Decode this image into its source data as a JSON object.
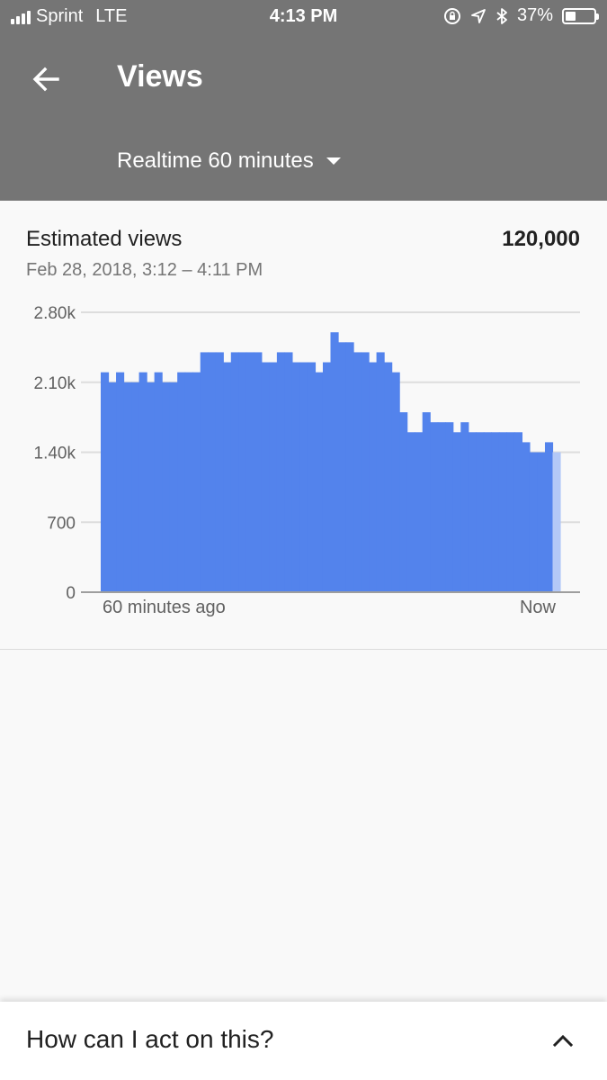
{
  "status_bar": {
    "carrier": "Sprint",
    "network": "LTE",
    "time": "4:13 PM",
    "battery_percent_label": "37%",
    "battery_level": 0.37,
    "icons": [
      "signal-icon",
      "rotation-lock-icon",
      "location-icon",
      "bluetooth-icon",
      "battery-icon"
    ]
  },
  "header": {
    "title": "Views",
    "period_selector": "Realtime 60 minutes",
    "back_icon": "arrow-left-icon",
    "dropdown_icon": "caret-down-icon"
  },
  "metric": {
    "label": "Estimated views",
    "value": "120,000",
    "date_range": "Feb 28, 2018, 3:12 – 4:11 PM"
  },
  "chart_data": {
    "type": "bar",
    "title": "",
    "xlabel": "",
    "ylabel": "",
    "ylim": [
      0,
      2800
    ],
    "yticks": [
      {
        "value": 0,
        "label": "0"
      },
      {
        "value": 700,
        "label": "700"
      },
      {
        "value": 1400,
        "label": "1.40k"
      },
      {
        "value": 2100,
        "label": "2.10k"
      },
      {
        "value": 2800,
        "label": "2.80k"
      }
    ],
    "x_start_label": "60 minutes ago",
    "x_end_label": "Now",
    "grid": true,
    "bar_color": "#5383EC",
    "current_bar_color": "#B3C8F7",
    "values": [
      2200,
      2100,
      2200,
      2100,
      2100,
      2200,
      2100,
      2200,
      2100,
      2100,
      2200,
      2200,
      2200,
      2400,
      2400,
      2400,
      2300,
      2400,
      2400,
      2400,
      2400,
      2300,
      2300,
      2400,
      2400,
      2300,
      2300,
      2300,
      2200,
      2300,
      2600,
      2500,
      2500,
      2400,
      2400,
      2300,
      2400,
      2300,
      2200,
      1800,
      1600,
      1600,
      1800,
      1700,
      1700,
      1700,
      1600,
      1700,
      1600,
      1600,
      1600,
      1600,
      1600,
      1600,
      1600,
      1500,
      1400,
      1400,
      1500,
      1400
    ]
  },
  "colors": {
    "header_bg": "#757575",
    "page_bg": "#F9F9F9",
    "bar": "#5383EC",
    "bar_current": "#B3C8F7"
  },
  "bottom_sheet": {
    "question": "How can I act on this?",
    "toggle_icon": "chevron-up-icon"
  }
}
